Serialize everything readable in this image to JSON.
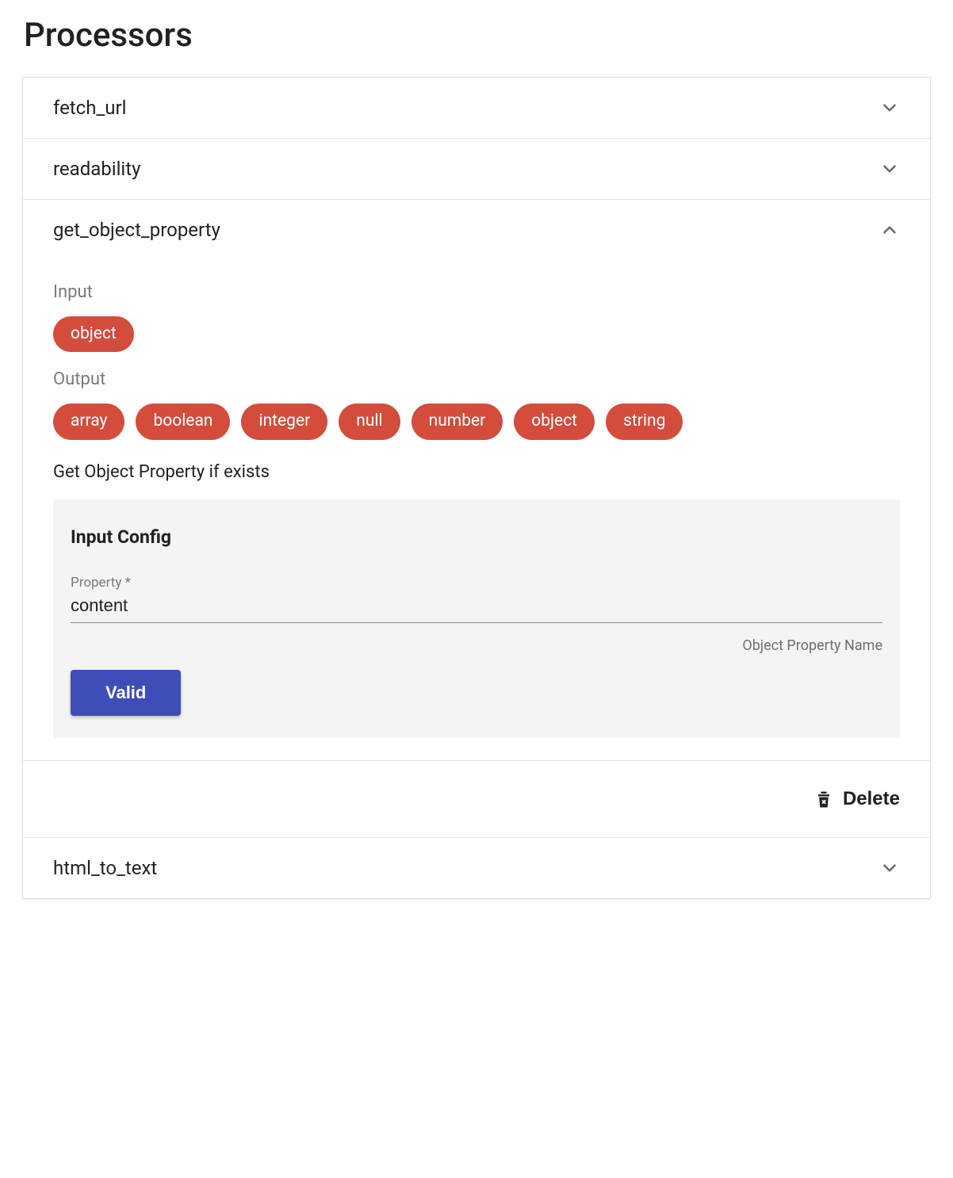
{
  "page_title": "Processors",
  "processors": [
    {
      "name": "fetch_url",
      "expanded": false
    },
    {
      "name": "readability",
      "expanded": false
    },
    {
      "name": "get_object_property",
      "expanded": true,
      "input_label": "Input",
      "input_types": [
        "object"
      ],
      "output_label": "Output",
      "output_types": [
        "array",
        "boolean",
        "integer",
        "null",
        "number",
        "object",
        "string"
      ],
      "description": "Get Object Property if exists",
      "config": {
        "heading": "Input Config",
        "field_label": "Property *",
        "field_value": "content",
        "field_helper": "Object Property Name",
        "submit_label": "Valid"
      },
      "delete_label": "Delete"
    },
    {
      "name": "html_to_text",
      "expanded": false
    }
  ]
}
